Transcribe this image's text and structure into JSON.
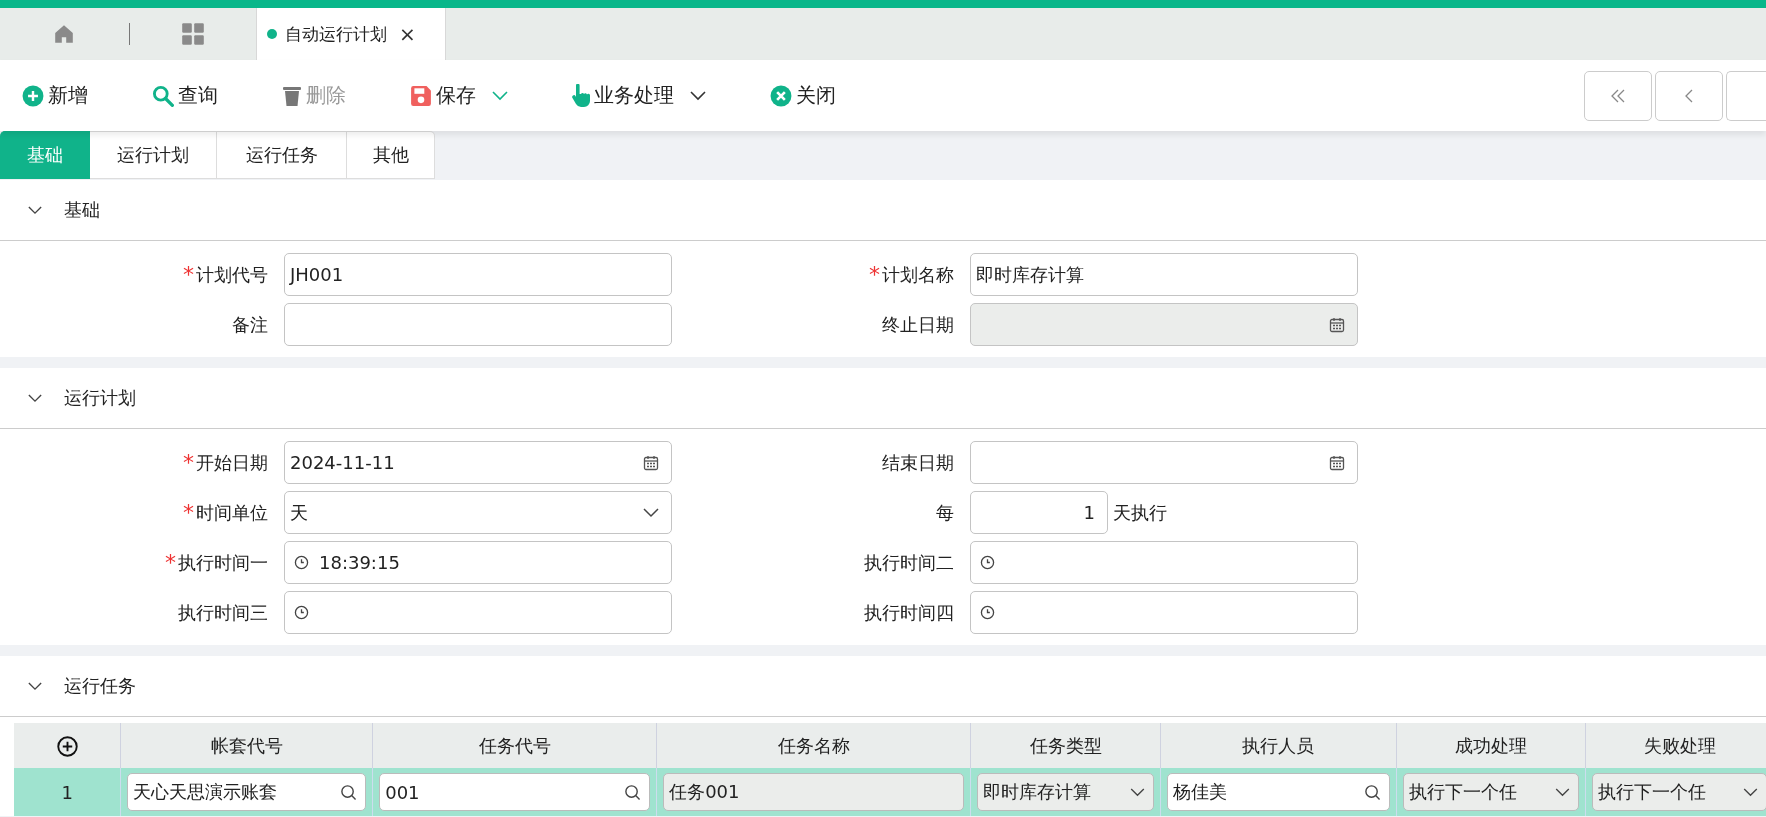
{
  "tab_bar": {
    "tabs": [
      {
        "label": "自动运行计划",
        "selected": true,
        "close": "×"
      }
    ]
  },
  "toolbar": {
    "buttons": [
      {
        "kind": "add",
        "label": "新增",
        "disabled": false,
        "menu": false
      },
      {
        "kind": "search",
        "label": "查询",
        "disabled": false,
        "menu": false
      },
      {
        "kind": "delete",
        "label": "删除",
        "disabled": true,
        "menu": false
      },
      {
        "kind": "save",
        "label": "保存",
        "disabled": false,
        "menu": true
      },
      {
        "kind": "action",
        "label": "业务处理",
        "disabled": false,
        "menu": true
      },
      {
        "kind": "close",
        "label": "关闭",
        "disabled": false,
        "menu": false
      }
    ]
  },
  "sub_tabs": [
    {
      "label": "基础",
      "selected": true
    },
    {
      "label": "运行计划",
      "selected": false
    },
    {
      "label": "运行任务",
      "selected": false
    },
    {
      "label": "其他",
      "selected": false
    }
  ],
  "sections": [
    {
      "title": "基础",
      "expanded": true,
      "fields": [
        {
          "label": "计划代号",
          "required_mark": "*",
          "kind": "text",
          "value": "JH001",
          "disabled": false
        },
        {
          "label": "计划名称",
          "required_mark": "*",
          "kind": "text",
          "value": "即时库存计算",
          "disabled": false
        },
        {
          "label": "备注",
          "kind": "text",
          "disabled": false
        },
        {
          "label": "终止日期",
          "kind": "date",
          "disabled": true
        }
      ]
    },
    {
      "title": "运行计划",
      "expanded": true,
      "fields": [
        {
          "label": "开始日期",
          "required_mark": "*",
          "kind": "date",
          "value": "2024-11-11",
          "disabled": false
        },
        {
          "label": "结束日期",
          "kind": "date",
          "disabled": false
        },
        {
          "label": "时间单位",
          "required_mark": "*",
          "kind": "select",
          "value": "天",
          "disabled": false
        },
        {
          "label": "每",
          "kind": "number",
          "value": "1",
          "suffix": "天执行",
          "disabled": false
        },
        {
          "label": "执行时间一",
          "required_mark": "*",
          "kind": "time",
          "value": "18:39:15",
          "disabled": false
        },
        {
          "label": "执行时间二",
          "kind": "time",
          "disabled": false
        },
        {
          "label": "执行时间三",
          "kind": "time",
          "disabled": false
        },
        {
          "label": "执行时间四",
          "kind": "time",
          "disabled": false
        }
      ]
    },
    {
      "title": "运行任务",
      "expanded": true
    }
  ],
  "task_table": {
    "columns": [
      "帐套代号",
      "任务代号",
      "任务名称",
      "任务类型",
      "执行人员",
      "成功处理",
      "失败处理"
    ],
    "rows": [
      {
        "index": "1",
        "selected": true,
        "cells": [
          {
            "kind": "lookup",
            "value": "天心天思演示账套"
          },
          {
            "kind": "lookup",
            "value": "001"
          },
          {
            "kind": "readonly",
            "value": "任务001"
          },
          {
            "kind": "select",
            "value": "即时库存计算"
          },
          {
            "kind": "lookup",
            "value": "杨佳美"
          },
          {
            "kind": "select",
            "value": "执行下一个任"
          },
          {
            "kind": "select",
            "value": "执行下一个任"
          }
        ]
      }
    ]
  }
}
